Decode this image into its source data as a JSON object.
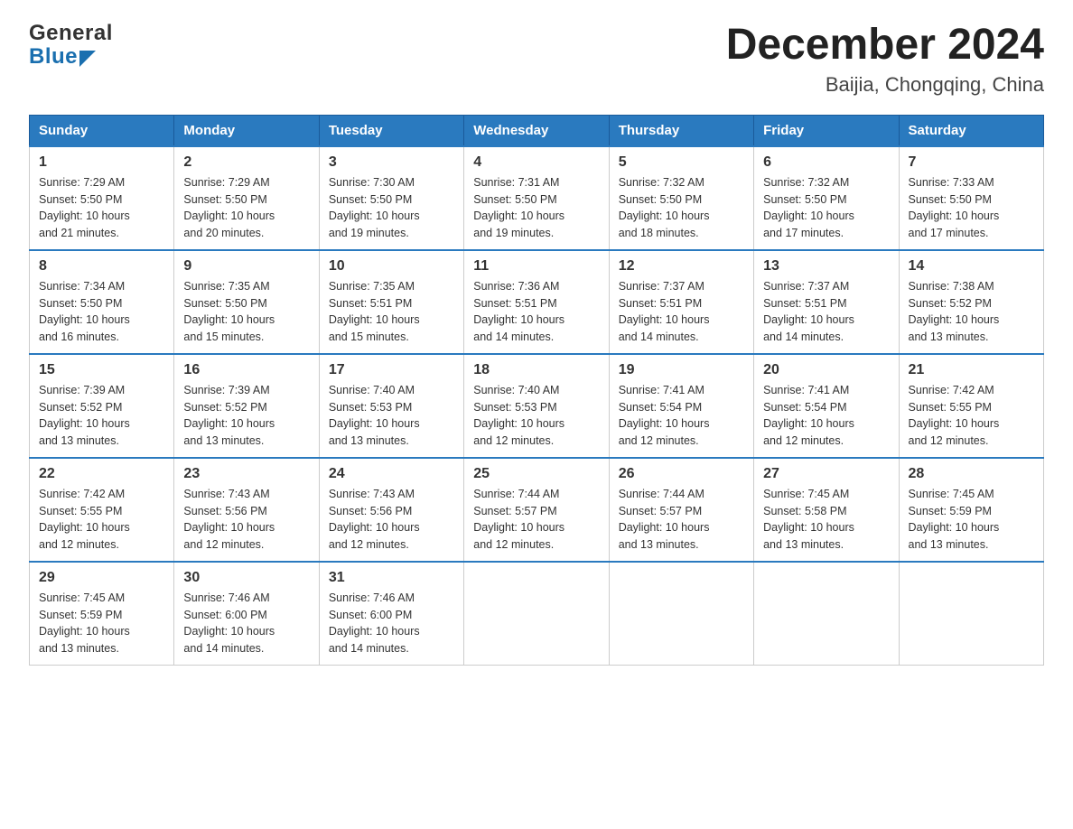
{
  "header": {
    "logo_general": "General",
    "logo_blue": "Blue",
    "title": "December 2024",
    "subtitle": "Baijia, Chongqing, China"
  },
  "days_of_week": [
    "Sunday",
    "Monday",
    "Tuesday",
    "Wednesday",
    "Thursday",
    "Friday",
    "Saturday"
  ],
  "weeks": [
    [
      {
        "day": "1",
        "info": "Sunrise: 7:29 AM\nSunset: 5:50 PM\nDaylight: 10 hours\nand 21 minutes."
      },
      {
        "day": "2",
        "info": "Sunrise: 7:29 AM\nSunset: 5:50 PM\nDaylight: 10 hours\nand 20 minutes."
      },
      {
        "day": "3",
        "info": "Sunrise: 7:30 AM\nSunset: 5:50 PM\nDaylight: 10 hours\nand 19 minutes."
      },
      {
        "day": "4",
        "info": "Sunrise: 7:31 AM\nSunset: 5:50 PM\nDaylight: 10 hours\nand 19 minutes."
      },
      {
        "day": "5",
        "info": "Sunrise: 7:32 AM\nSunset: 5:50 PM\nDaylight: 10 hours\nand 18 minutes."
      },
      {
        "day": "6",
        "info": "Sunrise: 7:32 AM\nSunset: 5:50 PM\nDaylight: 10 hours\nand 17 minutes."
      },
      {
        "day": "7",
        "info": "Sunrise: 7:33 AM\nSunset: 5:50 PM\nDaylight: 10 hours\nand 17 minutes."
      }
    ],
    [
      {
        "day": "8",
        "info": "Sunrise: 7:34 AM\nSunset: 5:50 PM\nDaylight: 10 hours\nand 16 minutes."
      },
      {
        "day": "9",
        "info": "Sunrise: 7:35 AM\nSunset: 5:50 PM\nDaylight: 10 hours\nand 15 minutes."
      },
      {
        "day": "10",
        "info": "Sunrise: 7:35 AM\nSunset: 5:51 PM\nDaylight: 10 hours\nand 15 minutes."
      },
      {
        "day": "11",
        "info": "Sunrise: 7:36 AM\nSunset: 5:51 PM\nDaylight: 10 hours\nand 14 minutes."
      },
      {
        "day": "12",
        "info": "Sunrise: 7:37 AM\nSunset: 5:51 PM\nDaylight: 10 hours\nand 14 minutes."
      },
      {
        "day": "13",
        "info": "Sunrise: 7:37 AM\nSunset: 5:51 PM\nDaylight: 10 hours\nand 14 minutes."
      },
      {
        "day": "14",
        "info": "Sunrise: 7:38 AM\nSunset: 5:52 PM\nDaylight: 10 hours\nand 13 minutes."
      }
    ],
    [
      {
        "day": "15",
        "info": "Sunrise: 7:39 AM\nSunset: 5:52 PM\nDaylight: 10 hours\nand 13 minutes."
      },
      {
        "day": "16",
        "info": "Sunrise: 7:39 AM\nSunset: 5:52 PM\nDaylight: 10 hours\nand 13 minutes."
      },
      {
        "day": "17",
        "info": "Sunrise: 7:40 AM\nSunset: 5:53 PM\nDaylight: 10 hours\nand 13 minutes."
      },
      {
        "day": "18",
        "info": "Sunrise: 7:40 AM\nSunset: 5:53 PM\nDaylight: 10 hours\nand 12 minutes."
      },
      {
        "day": "19",
        "info": "Sunrise: 7:41 AM\nSunset: 5:54 PM\nDaylight: 10 hours\nand 12 minutes."
      },
      {
        "day": "20",
        "info": "Sunrise: 7:41 AM\nSunset: 5:54 PM\nDaylight: 10 hours\nand 12 minutes."
      },
      {
        "day": "21",
        "info": "Sunrise: 7:42 AM\nSunset: 5:55 PM\nDaylight: 10 hours\nand 12 minutes."
      }
    ],
    [
      {
        "day": "22",
        "info": "Sunrise: 7:42 AM\nSunset: 5:55 PM\nDaylight: 10 hours\nand 12 minutes."
      },
      {
        "day": "23",
        "info": "Sunrise: 7:43 AM\nSunset: 5:56 PM\nDaylight: 10 hours\nand 12 minutes."
      },
      {
        "day": "24",
        "info": "Sunrise: 7:43 AM\nSunset: 5:56 PM\nDaylight: 10 hours\nand 12 minutes."
      },
      {
        "day": "25",
        "info": "Sunrise: 7:44 AM\nSunset: 5:57 PM\nDaylight: 10 hours\nand 12 minutes."
      },
      {
        "day": "26",
        "info": "Sunrise: 7:44 AM\nSunset: 5:57 PM\nDaylight: 10 hours\nand 13 minutes."
      },
      {
        "day": "27",
        "info": "Sunrise: 7:45 AM\nSunset: 5:58 PM\nDaylight: 10 hours\nand 13 minutes."
      },
      {
        "day": "28",
        "info": "Sunrise: 7:45 AM\nSunset: 5:59 PM\nDaylight: 10 hours\nand 13 minutes."
      }
    ],
    [
      {
        "day": "29",
        "info": "Sunrise: 7:45 AM\nSunset: 5:59 PM\nDaylight: 10 hours\nand 13 minutes."
      },
      {
        "day": "30",
        "info": "Sunrise: 7:46 AM\nSunset: 6:00 PM\nDaylight: 10 hours\nand 14 minutes."
      },
      {
        "day": "31",
        "info": "Sunrise: 7:46 AM\nSunset: 6:00 PM\nDaylight: 10 hours\nand 14 minutes."
      },
      {
        "day": "",
        "info": ""
      },
      {
        "day": "",
        "info": ""
      },
      {
        "day": "",
        "info": ""
      },
      {
        "day": "",
        "info": ""
      }
    ]
  ]
}
